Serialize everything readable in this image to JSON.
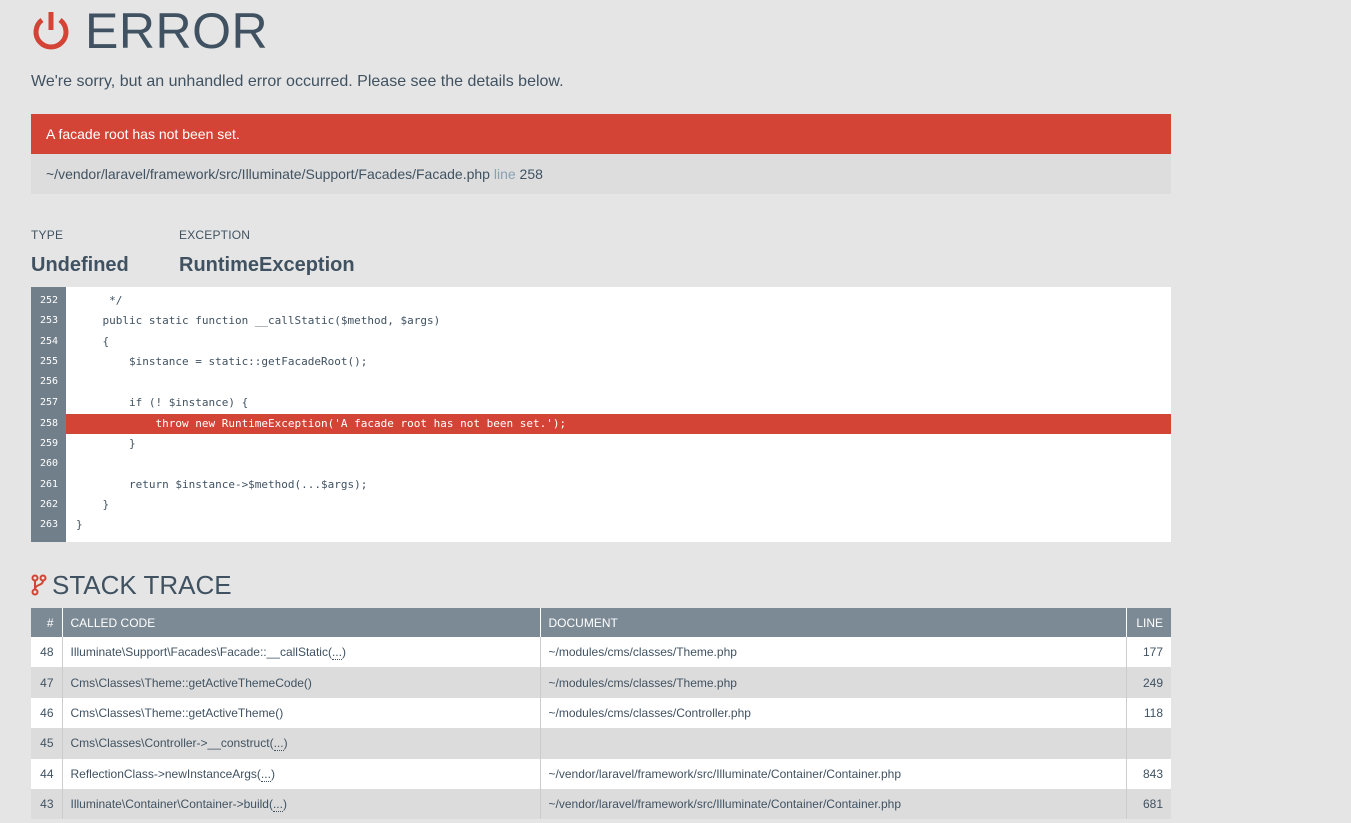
{
  "header": {
    "title": "ERROR",
    "message": "We're sorry, but an unhandled error occurred. Please see the details below."
  },
  "error": {
    "message": "A facade root has not been set.",
    "file": "~/vendor/laravel/framework/src/Illuminate/Support/Facades/Facade.php",
    "line_label": "line",
    "line": "258"
  },
  "meta": {
    "type_label": "TYPE",
    "type_value": "Undefined",
    "exception_label": "EXCEPTION",
    "exception_value": "RuntimeException"
  },
  "code": [
    {
      "n": "252",
      "text": "     */"
    },
    {
      "n": "253",
      "text": "    public static function __callStatic($method, $args)"
    },
    {
      "n": "254",
      "text": "    {"
    },
    {
      "n": "255",
      "text": "        $instance = static::getFacadeRoot();"
    },
    {
      "n": "256",
      "text": ""
    },
    {
      "n": "257",
      "text": "        if (! $instance) {"
    },
    {
      "n": "258",
      "text": "            throw new RuntimeException('A facade root has not been set.');"
    },
    {
      "n": "259",
      "text": "        }"
    },
    {
      "n": "260",
      "text": ""
    },
    {
      "n": "261",
      "text": "        return $instance->$method(...$args);"
    },
    {
      "n": "262",
      "text": "    }"
    },
    {
      "n": "263",
      "text": "}"
    }
  ],
  "stack": {
    "title": "STACK TRACE",
    "columns": {
      "num": "#",
      "code": "CALLED CODE",
      "doc": "DOCUMENT",
      "line": "LINE"
    },
    "rows": [
      {
        "num": "48",
        "call": "Illuminate\\Support\\Facades\\Facade::__callStatic(",
        "args": "...",
        "close": ")",
        "doc": "~/modules/cms/classes/Theme.php",
        "line": "177"
      },
      {
        "num": "47",
        "call": "Cms\\Classes\\Theme::getActiveThemeCode()",
        "args": "",
        "close": "",
        "doc": "~/modules/cms/classes/Theme.php",
        "line": "249"
      },
      {
        "num": "46",
        "call": "Cms\\Classes\\Theme::getActiveTheme()",
        "args": "",
        "close": "",
        "doc": "~/modules/cms/classes/Controller.php",
        "line": "118"
      },
      {
        "num": "45",
        "call": "Cms\\Classes\\Controller->__construct(",
        "args": "...",
        "close": ")",
        "doc": "",
        "line": ""
      },
      {
        "num": "44",
        "call": "ReflectionClass->newInstanceArgs(",
        "args": "...",
        "close": ")",
        "doc": "~/vendor/laravel/framework/src/Illuminate/Container/Container.php",
        "line": "843"
      },
      {
        "num": "43",
        "call": "Illuminate\\Container\\Container->build(",
        "args": "...",
        "close": ")",
        "doc": "~/vendor/laravel/framework/src/Illuminate/Container/Container.php",
        "line": "681"
      }
    ]
  },
  "colors": {
    "accent": "#d34436",
    "text": "#405261",
    "gutter": "#717f8a"
  }
}
